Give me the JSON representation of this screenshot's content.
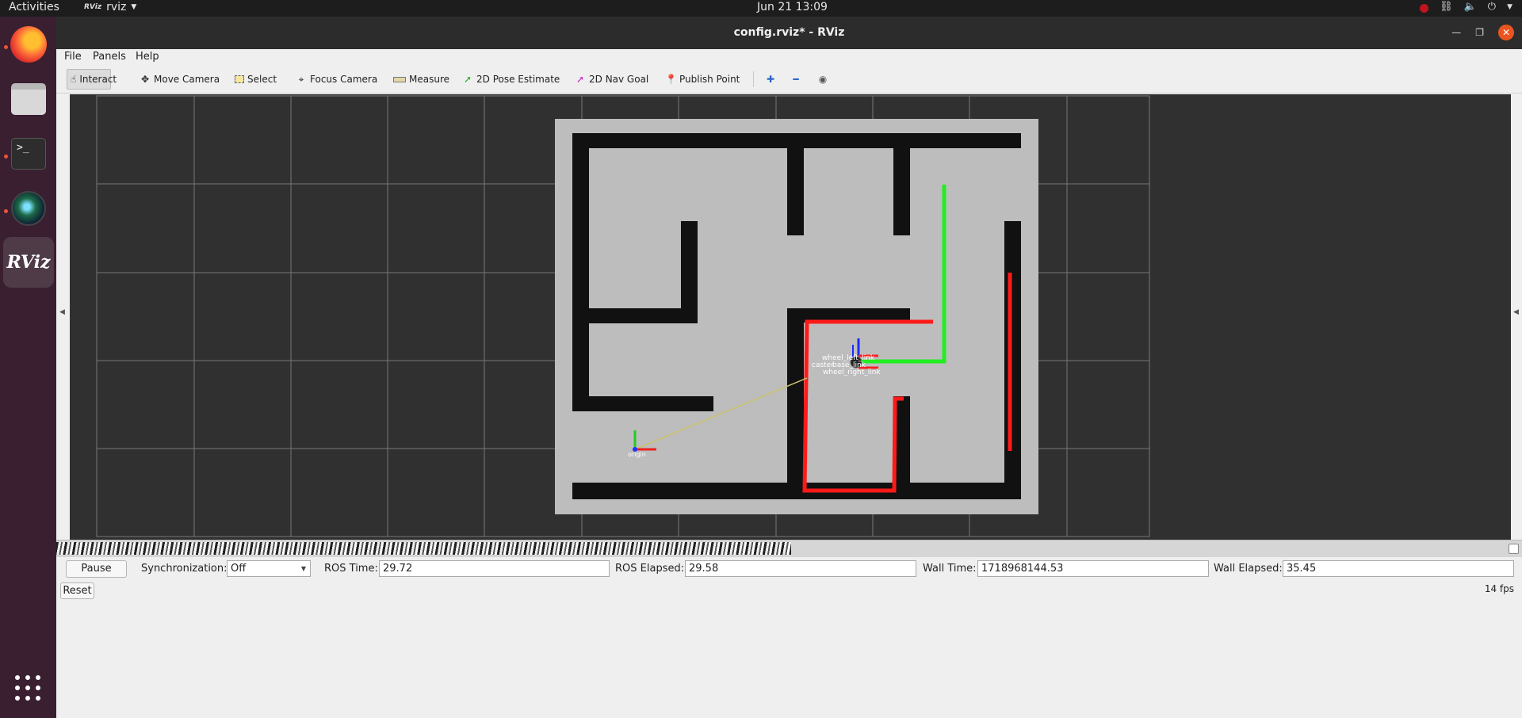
{
  "topbar": {
    "activities": "Activities",
    "app_name": "rviz",
    "app_logo": "RViz",
    "clock": "Jun 21  13:09"
  },
  "dock": {
    "items": [
      "firefox-icon",
      "files-icon",
      "terminal-icon",
      "camera-icon",
      "rviz-icon"
    ],
    "terminal_prompt": ">_",
    "rviz_label": "RViz"
  },
  "window": {
    "title": "config.rviz* - RViz"
  },
  "menu": {
    "file": "File",
    "panels": "Panels",
    "help": "Help"
  },
  "toolbar": {
    "interact": "Interact",
    "move_camera": "Move Camera",
    "select": "Select",
    "focus_camera": "Focus Camera",
    "measure": "Measure",
    "pose_estimate": "2D Pose Estimate",
    "nav_goal": "2D Nav Goal",
    "publish_point": "Publish Point"
  },
  "viewport": {
    "frame_labels": {
      "wheel_left": "wheel_left_link",
      "caster": "caster",
      "base": "base_link",
      "wheel_right": "wheel_right_link",
      "origin": "origin"
    },
    "colors": {
      "background": "#303030",
      "map_free": "#bdbdbd",
      "map_wall": "#0f0f0f",
      "grid": "#7a7a7a",
      "laser": "#ff0000",
      "path": "#22ee22"
    }
  },
  "time_panel": {
    "pause": "Pause",
    "sync_label": "Synchronization:",
    "sync_value": "Off",
    "ros_time_label": "ROS Time:",
    "ros_time": "29.72",
    "ros_elapsed_label": "ROS Elapsed:",
    "ros_elapsed": "29.58",
    "wall_time_label": "Wall Time:",
    "wall_time": "1718968144.53",
    "wall_elapsed_label": "Wall Elapsed:",
    "wall_elapsed": "35.45",
    "reset": "Reset",
    "fps": "14 fps"
  }
}
